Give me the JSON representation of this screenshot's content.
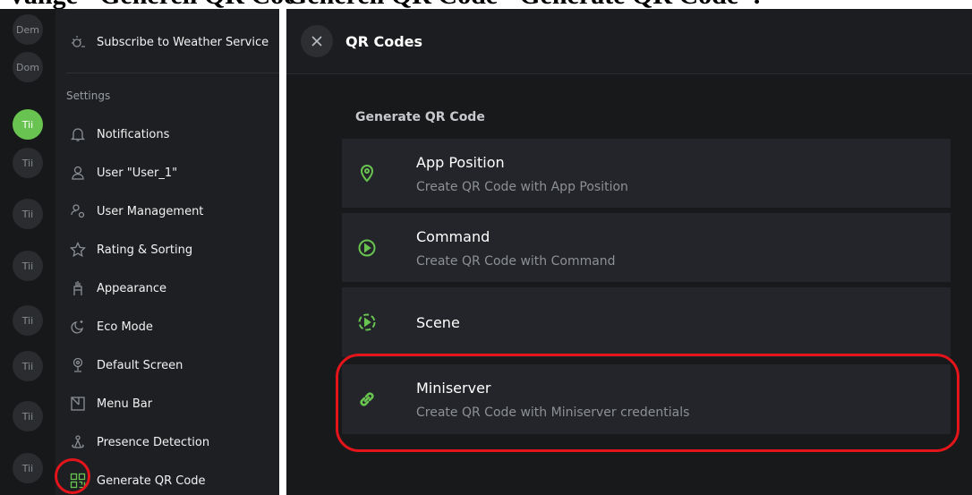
{
  "caption": {
    "left": "Vange \"Generell QR Code\"",
    "right": "Generell QR Code \"Generate QR Code\"."
  },
  "rail": {
    "avatars": [
      "Dem",
      "Dom",
      "Tii",
      "Tii",
      "Tii",
      "Tii",
      "Tii",
      "Tii",
      "Tii",
      "Tii"
    ]
  },
  "menu": {
    "top_item": "Subscribe to Weather Service",
    "section_label": "Settings",
    "items": [
      {
        "label": "Notifications",
        "icon": "bell-icon"
      },
      {
        "label": "User \"User_1\"",
        "icon": "user-icon"
      },
      {
        "label": "User Management",
        "icon": "user-management-icon"
      },
      {
        "label": "Rating & Sorting",
        "icon": "star-icon"
      },
      {
        "label": "Appearance",
        "icon": "appearance-icon"
      },
      {
        "label": "Eco Mode",
        "icon": "eco-mode-icon"
      },
      {
        "label": "Default Screen",
        "icon": "default-screen-icon"
      },
      {
        "label": "Menu Bar",
        "icon": "menu-bar-icon"
      },
      {
        "label": "Presence Detection",
        "icon": "presence-detection-icon"
      },
      {
        "label": "Generate QR Code",
        "icon": "qr-code-icon"
      }
    ]
  },
  "qr": {
    "header_title": "QR Codes",
    "section_title": "Generate QR Code",
    "cards": [
      {
        "title": "App Position",
        "subtitle": "Create QR Code with App Position",
        "icon": "location-pin-icon"
      },
      {
        "title": "Command",
        "subtitle": "Create QR Code with Command",
        "icon": "play-circle-icon"
      },
      {
        "title": "Scene",
        "subtitle": "",
        "icon": "scene-icon"
      },
      {
        "title": "Miniserver",
        "subtitle": "Create QR Code with Miniserver credentials",
        "icon": "link-icon"
      }
    ]
  },
  "colors": {
    "accent_green": "#69c350",
    "highlight_red": "#e3151b",
    "panel_bg": "#18191b",
    "card_bg": "#23252a"
  }
}
